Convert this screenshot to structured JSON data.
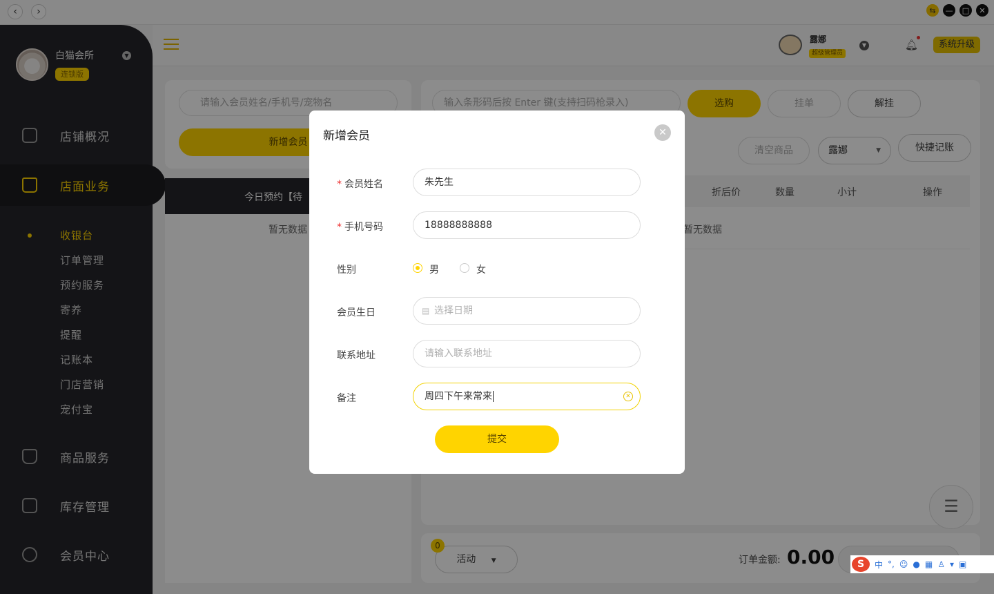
{
  "window": {
    "back_glyph": "‹",
    "forward_glyph": "›",
    "controls": [
      {
        "name": "swap-icon",
        "glyph": "⇆",
        "color": "#f5c400"
      },
      {
        "name": "minimize-icon",
        "glyph": "—",
        "color": "#111111"
      },
      {
        "name": "maximize-icon",
        "glyph": "□",
        "color": "#111111"
      },
      {
        "name": "close-icon",
        "glyph": "✕",
        "color": "#111111"
      }
    ]
  },
  "sidebar": {
    "store_name": "白猫会所",
    "store_badge": "连锁版",
    "nav": [
      {
        "label": "店铺概况",
        "icon": "monitor-icon"
      },
      {
        "label": "店面业务",
        "icon": "home-icon"
      },
      {
        "label": "商品服务",
        "icon": "bag-icon"
      },
      {
        "label": "库存管理",
        "icon": "box-icon"
      },
      {
        "label": "会员中心",
        "icon": "member-icon"
      }
    ],
    "sub_items": [
      "收银台",
      "订单管理",
      "预约服务",
      "寄养",
      "提醒",
      "记账本",
      "门店营销",
      "宠付宝"
    ]
  },
  "header": {
    "user_name": "露娜",
    "user_role": "超级管理员",
    "upgrade_label": "系统升级"
  },
  "left_panel": {
    "search_placeholder": "请输入会员姓名/手机号/宠物名",
    "new_member_label": "新增会员",
    "tab_label": "今日预约【待",
    "empty_text": "暂无数据"
  },
  "right_panel": {
    "barcode_placeholder": "输入条形码后按 Enter 键(支持扫码枪录入)",
    "select_label": "选购",
    "hold_label": "挂单",
    "release_label": "解挂",
    "clear_label": "清空商品",
    "staff_select": "露娜",
    "quick_label": "快捷记账",
    "columns": [
      "折后价",
      "数量",
      "小计",
      "操作"
    ],
    "empty_text": "暂无数据",
    "activity_badge": "0",
    "activity_label": "活动",
    "order_total_label": "订单金额:",
    "order_total_value": "0.00"
  },
  "modal": {
    "title": "新增会员",
    "fields": {
      "name_label": "会员姓名",
      "name_value": "朱先生",
      "phone_label": "手机号码",
      "phone_value": "18888888888",
      "gender_label": "性别",
      "gender_male": "男",
      "gender_female": "女",
      "birthday_label": "会员生日",
      "birthday_placeholder": "选择日期",
      "address_label": "联系地址",
      "address_placeholder": "请输入联系地址",
      "note_label": "备注",
      "note_value": "周四下午来常来"
    },
    "required_mark": "*",
    "submit_label": "提交"
  },
  "ime": {
    "logo": "S",
    "mode": "中",
    "punct": "°,"
  }
}
